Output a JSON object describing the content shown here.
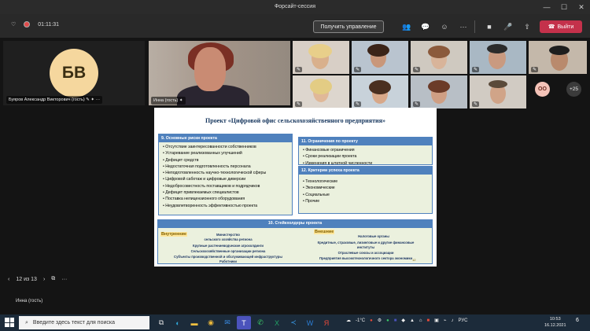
{
  "window": {
    "title": "Форсайт-сессия",
    "controls": [
      "—",
      "☐",
      "✕"
    ]
  },
  "toolbar": {
    "timer": "01:11:31",
    "control_label": "Получить управление",
    "leave_label": "Выйти"
  },
  "participants": {
    "main_initials": "БВ",
    "main_name": "Буяров Александр Викторович (гость)",
    "inna_name": "Инна (гость)",
    "oo_initials": "ОО",
    "more_count": "+25"
  },
  "slide": {
    "title": "Проект «Цифровой офис сельскохозяйственного предприятия»",
    "risks": {
      "heading": "9. Основные риски проекта",
      "items": [
        "Отсутствие заинтересованности собственников",
        "Устаревание реализованных улучшений",
        "Дефицит средств",
        "Недостаточная подготовленность персонала",
        "Неподготовленность научно-технологической сферы",
        "Цифровой саботаж и цифровые диверсии",
        "Недобросовестность поставщиков и подрядчиков",
        "Дефицит привлекаемых специалистов",
        "Поставка нелицензионного оборудования",
        "Неудовлетворенность эффективностью проекта"
      ]
    },
    "limits": {
      "heading": "11. Ограничения по проекту",
      "items": [
        "Финансовые ограничения",
        "Сроки реализации проекта",
        "Изменения в штатной численности"
      ]
    },
    "criteria": {
      "heading": "12. Критерии успеха проекта",
      "items": [
        "Технологические",
        "Экономические",
        "Социальные",
        "Прочие"
      ]
    },
    "stakeholders": {
      "heading": "10. Стейкхолдеры проекта",
      "internal_label": "Внутренние",
      "external_label": "Внешние",
      "internal": [
        "Министерство",
        "сельского хозяйства региона",
        "Крупные растениеводческие агрохолдинги",
        "Сельскохозяйственные организации региона",
        "Субъекты производственной и обслуживающей инфраструктуры",
        "Работники"
      ],
      "external": [
        "Налоговые органы",
        "Кредитные, страховые, лизинговые и другие финансовые",
        "институты",
        "Отраслевые союзы и ассоциации",
        "Предприятия высокотехнологичного сектора экономики"
      ],
      "page_no": "12"
    }
  },
  "pager": {
    "text": "12 из 13"
  },
  "presenter": {
    "name": "Инна (гость)"
  },
  "taskbar": {
    "search_placeholder": "Введите здесь текст для поиска",
    "weather": "-1°C",
    "lang": "РУС",
    "time": "10:53",
    "date": "16.12.2021",
    "notifications": "6"
  }
}
